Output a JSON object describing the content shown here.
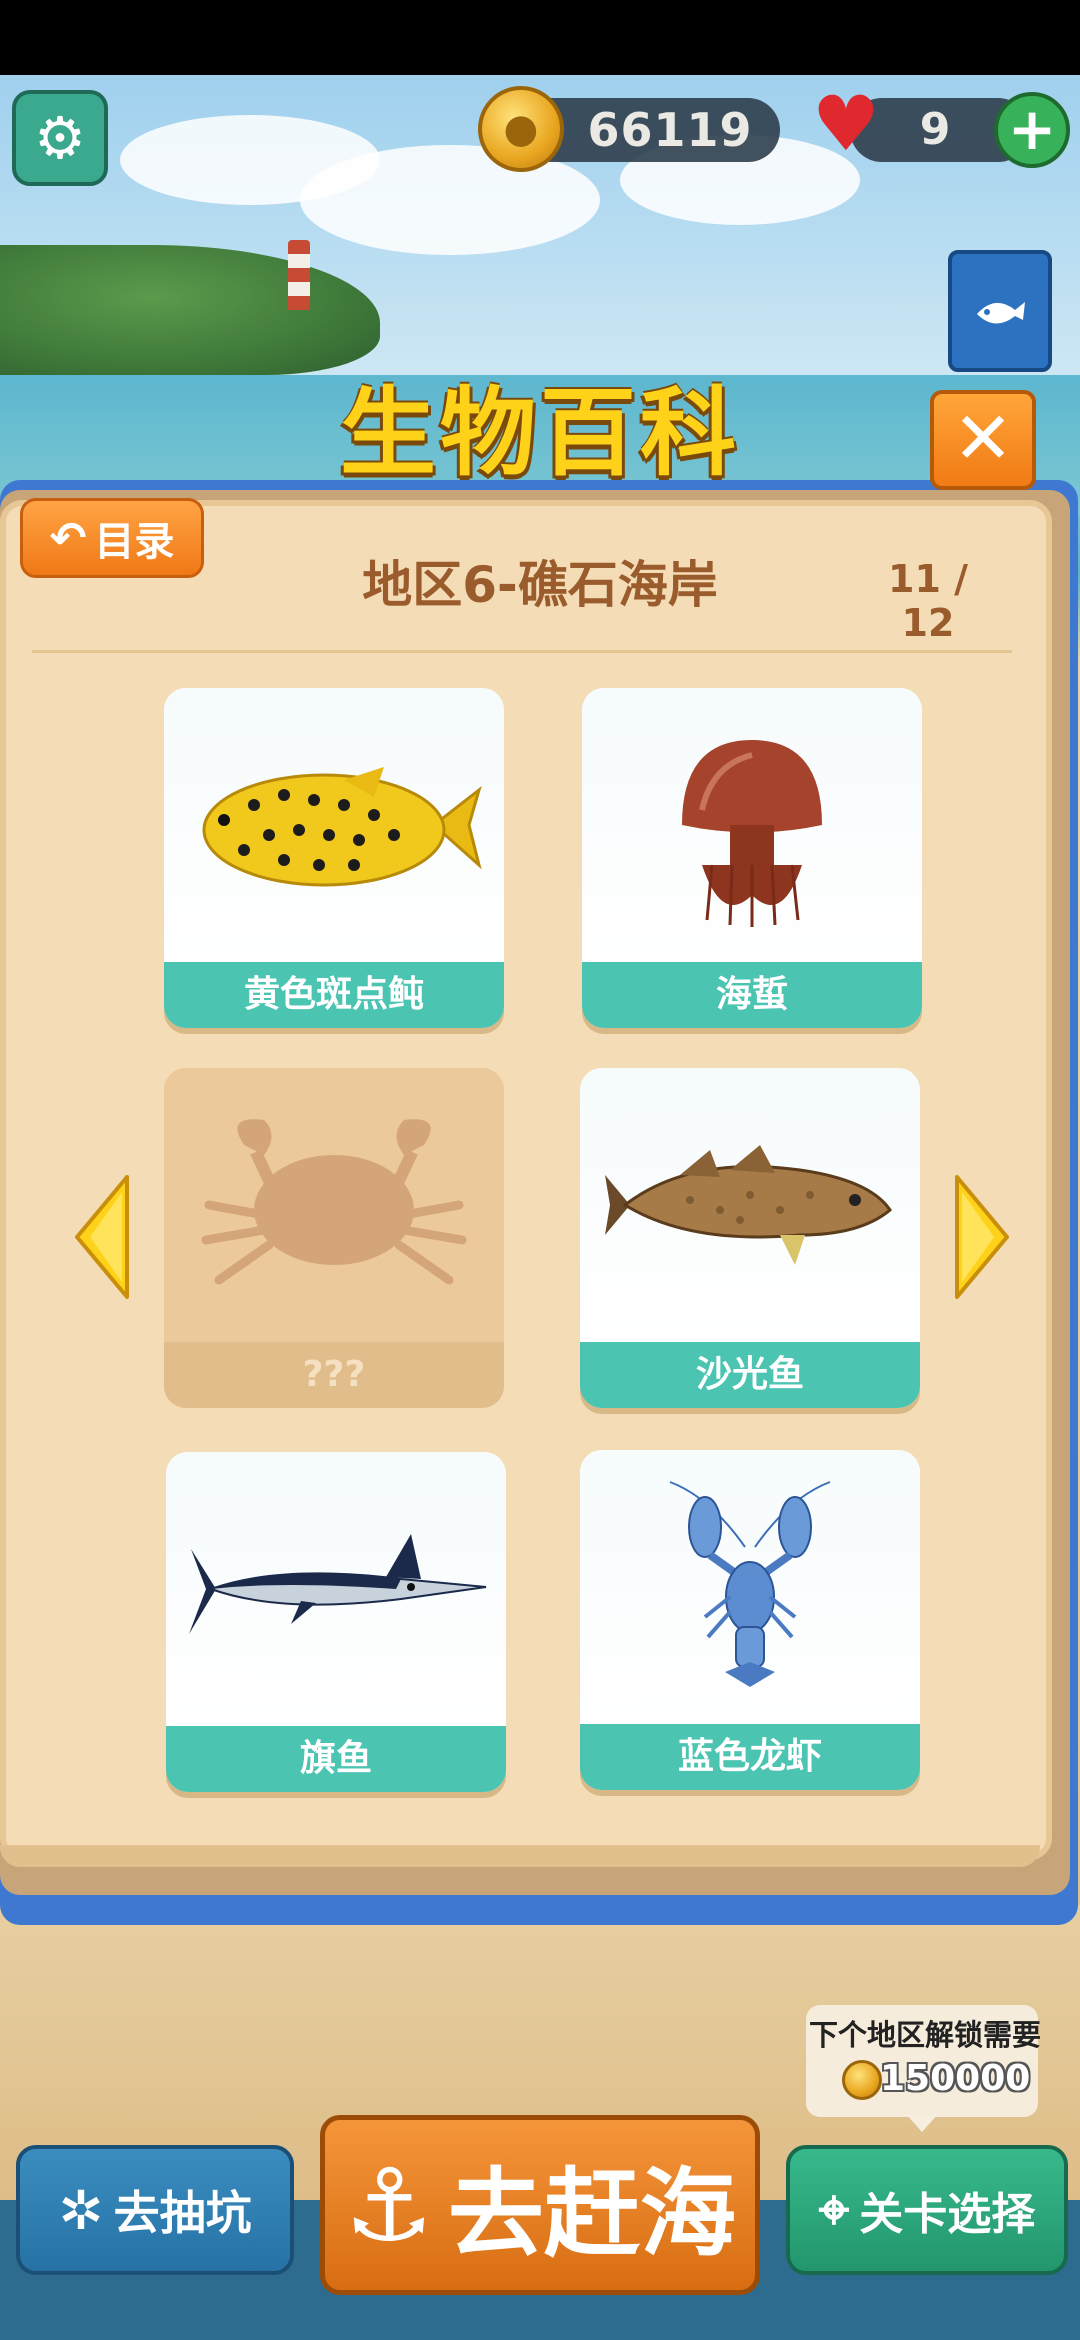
{
  "hud": {
    "coins": "66119",
    "lives": "9",
    "plus_label": "+"
  },
  "title": "生物百科",
  "panel": {
    "back_label": "目录",
    "region_title": "地区6-礁石海岸",
    "page_counter": "11 / 12",
    "cards": [
      {
        "name": "黄色斑点鲀",
        "locked": false,
        "icon": "yellow-spotted-pufferfish"
      },
      {
        "name": "海蜇",
        "locked": false,
        "icon": "jellyfish"
      },
      {
        "name": "???",
        "locked": true,
        "icon": "crab-silhouette"
      },
      {
        "name": "沙光鱼",
        "locked": false,
        "icon": "cod-fish"
      },
      {
        "name": "旗鱼",
        "locked": false,
        "icon": "marlin"
      },
      {
        "name": "蓝色龙虾",
        "locked": false,
        "icon": "blue-lobster"
      }
    ]
  },
  "unlock": {
    "text": "下个地区解锁需要",
    "amount": "150000"
  },
  "bottom": {
    "gacha_label": "去抽坑",
    "sea_label": "去赶海",
    "level_label": "关卡选择"
  },
  "colors": {
    "accent_teal": "#4bc4b2",
    "title_yellow": "#ffd21a",
    "panel_bg": "#f4ddb6",
    "frame_blue": "#3f78d0"
  }
}
